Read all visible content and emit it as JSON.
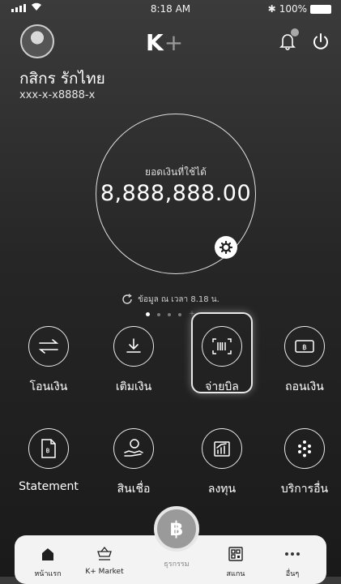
{
  "status_bar": {
    "time": "8:18 AM",
    "battery": "100%"
  },
  "header": {
    "logo_k": "K",
    "logo_plus": "+"
  },
  "account": {
    "name": "กสิกร รักไทย",
    "number": "xxx-x-x8888-x"
  },
  "balance": {
    "label": "ยอดเงินที่ใช้ได้",
    "amount": "8,888,888.00"
  },
  "updated_text": "ข้อมูล ณ เวลา 8.18 น.",
  "menu": [
    {
      "label": "โอนเงิน",
      "icon": "transfer-icon"
    },
    {
      "label": "เติมเงิน",
      "icon": "topup-icon"
    },
    {
      "label": "จ่ายบิล",
      "icon": "scan-bill-icon"
    },
    {
      "label": "ถอนเงิน",
      "icon": "withdraw-icon"
    },
    {
      "label": "Statement",
      "icon": "statement-icon"
    },
    {
      "label": "สินเชื่อ",
      "icon": "loan-icon"
    },
    {
      "label": "ลงทุน",
      "icon": "invest-icon"
    },
    {
      "label": "บริการอื่น",
      "icon": "more-services-icon"
    }
  ],
  "nav": {
    "home": "หน้าแรก",
    "market": "K+ Market",
    "center": "ธุรกรรม",
    "scan": "สแกน",
    "more": "อื่นๆ",
    "center_symbol": "฿"
  }
}
